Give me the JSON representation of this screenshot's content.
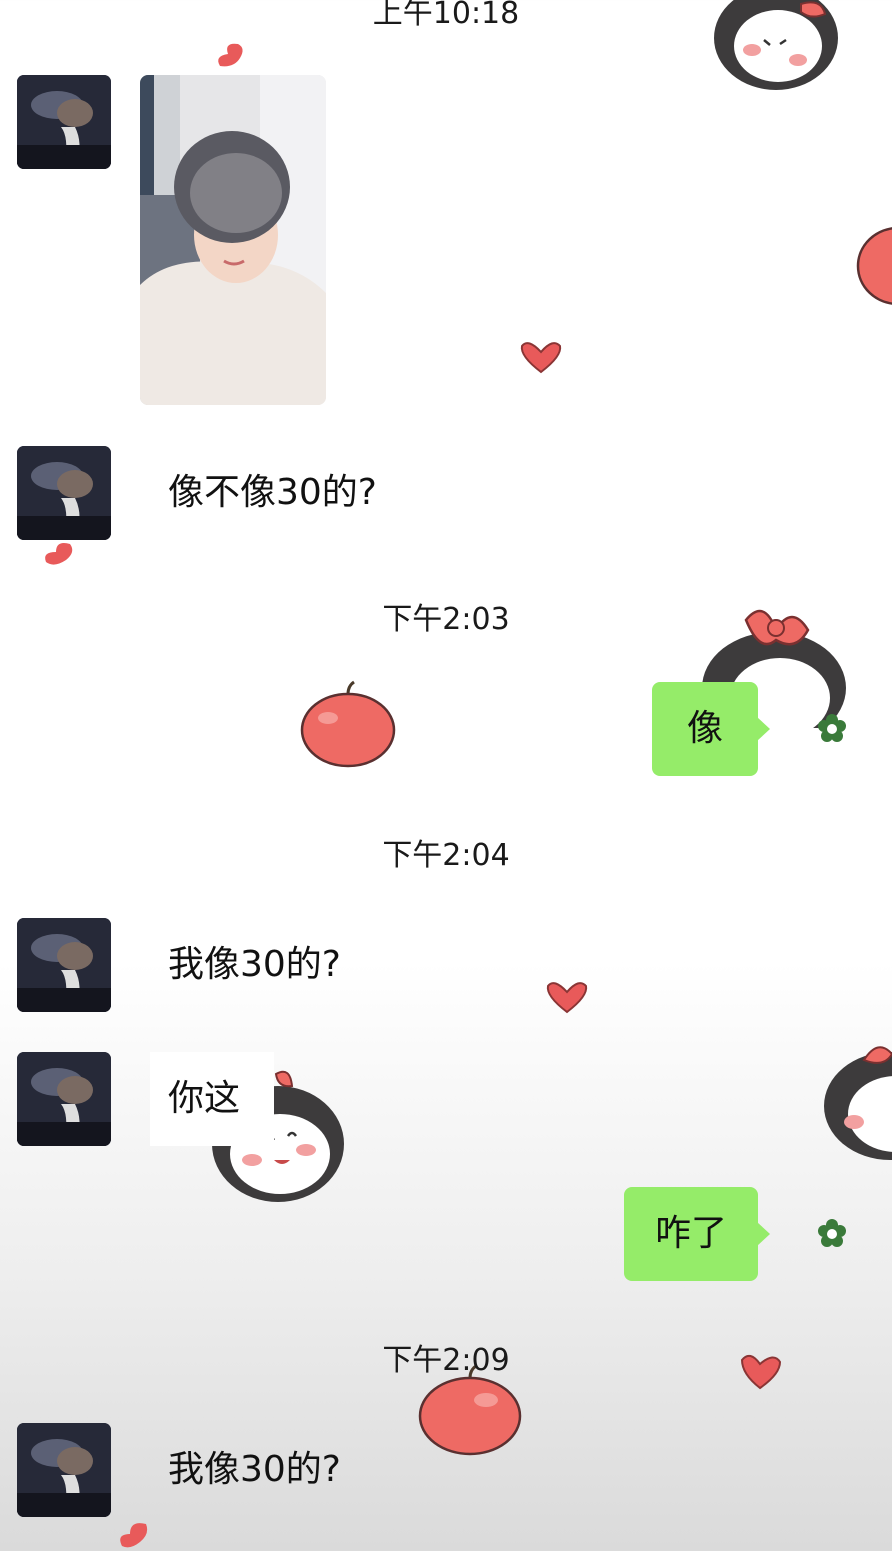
{
  "chat": {
    "messages": [
      {
        "type": "timestamp",
        "text": "上午10:18"
      },
      {
        "type": "image",
        "sender": "other"
      },
      {
        "type": "text",
        "sender": "other",
        "text": "像不像30的?"
      },
      {
        "type": "timestamp",
        "text": "下午2:03"
      },
      {
        "type": "text",
        "sender": "me",
        "text": "像"
      },
      {
        "type": "timestamp",
        "text": "下午2:04"
      },
      {
        "type": "text",
        "sender": "other",
        "text": "我像30的?"
      },
      {
        "type": "text",
        "sender": "other",
        "text": "你这"
      },
      {
        "type": "text",
        "sender": "me",
        "text": "咋了"
      },
      {
        "type": "timestamp",
        "text": "下午2:09"
      },
      {
        "type": "text",
        "sender": "other",
        "text": "我像30的?"
      }
    ]
  },
  "colors": {
    "sent_bubble": "#95ec69",
    "background": "#ffffff",
    "apple": "#ee6a64",
    "heart": "#e85a5a"
  },
  "icons": [
    "heart-icon",
    "apple-icon",
    "cartoon-girl-sticker",
    "flower-status-icon",
    "contact-avatar"
  ]
}
